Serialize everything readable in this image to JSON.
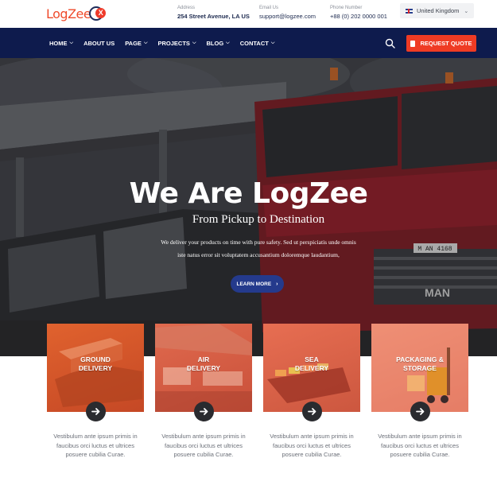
{
  "brand": {
    "logo_text": "LogZee",
    "logo_mark": "X"
  },
  "topbar": {
    "address_label": "Address",
    "address_value": "254 Street Avenue, LA US",
    "email_label": "Email Us",
    "email_value": "support@logzee.com",
    "phone_label": "Phone Number",
    "phone_value": "+88 (0) 202 0000 001",
    "country": "United Kingdom",
    "country_flag_icon": "uk-flag-icon"
  },
  "nav": {
    "items": [
      {
        "label": "HOME",
        "has_dropdown": true
      },
      {
        "label": "ABOUT US",
        "has_dropdown": false
      },
      {
        "label": "PAGE",
        "has_dropdown": true
      },
      {
        "label": "PROJECTS",
        "has_dropdown": true
      },
      {
        "label": "BLOG",
        "has_dropdown": true
      },
      {
        "label": "CONTACT",
        "has_dropdown": true
      }
    ],
    "search_icon": "search-icon",
    "quote_label": "REQUEST QUOTE"
  },
  "hero": {
    "title": "We Are LogZee",
    "subtitle": "From Pickup to Destination",
    "description": "We deliver your products on time with pure safety. Sed ut perspiciatis unde omnis iste natus error sit voluptatem accusantium doloremque laudantium,",
    "cta_label": "LEARN MORE",
    "truck_plate": "M AN 4168",
    "truck_badge": "MAN"
  },
  "services": [
    {
      "title": "GROUND DELIVERY",
      "title_line1": "GROUND",
      "title_line2": "DELIVERY",
      "description": "Vestibulum ante ipsum primis in faucibus orci luctus et ultrices posuere cubilia Curae."
    },
    {
      "title": "AIR DELIVERY",
      "title_line1": "AIR",
      "title_line2": "DELIVERY",
      "description": "Vestibulum ante ipsum primis in faucibus orci luctus et ultrices posuere cubilia Curae."
    },
    {
      "title": "SEA DELIVERY",
      "title_line1": "SEA",
      "title_line2": "DELIVERY",
      "description": "Vestibulum ante ipsum primis in faucibus orci luctus et ultrices posuere cubilia Curae."
    },
    {
      "title": "PACKAGING & STORAGE",
      "title_line1": "PACKAGING &",
      "title_line2": "STORAGE",
      "description": "Vestibulum ante ipsum primis in faucibus orci luctus et ultrices posuere cubilia Curae."
    }
  ],
  "colors": {
    "accent": "#ef3b24",
    "nav_bg": "#0e1b4d",
    "cta_bg": "#243a8c",
    "card_tint": "#e0622e"
  }
}
